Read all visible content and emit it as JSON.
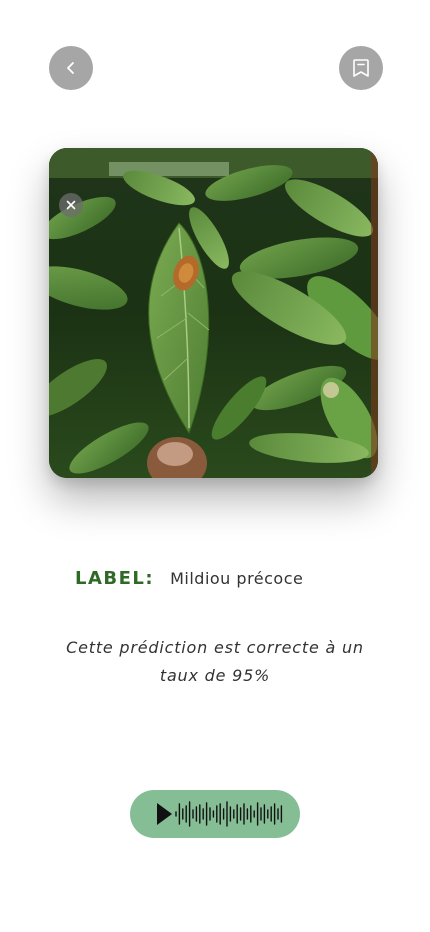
{
  "header": {
    "back_icon": "chevron-left-icon",
    "bookmark_icon": "bookmark-icon"
  },
  "photo": {
    "description_icon": "close-icon"
  },
  "result": {
    "label_key": "LABEL:",
    "label_value": "Mildiou précoce",
    "prediction_text": "Cette prédiction est correcte à un taux de 95%"
  },
  "audio": {
    "icon": "play-icon",
    "waveform_icon": "waveform-icon"
  },
  "colors": {
    "accent_green": "#2f6a25",
    "player_green": "#85be94",
    "button_gray": "#a6a6a6"
  }
}
